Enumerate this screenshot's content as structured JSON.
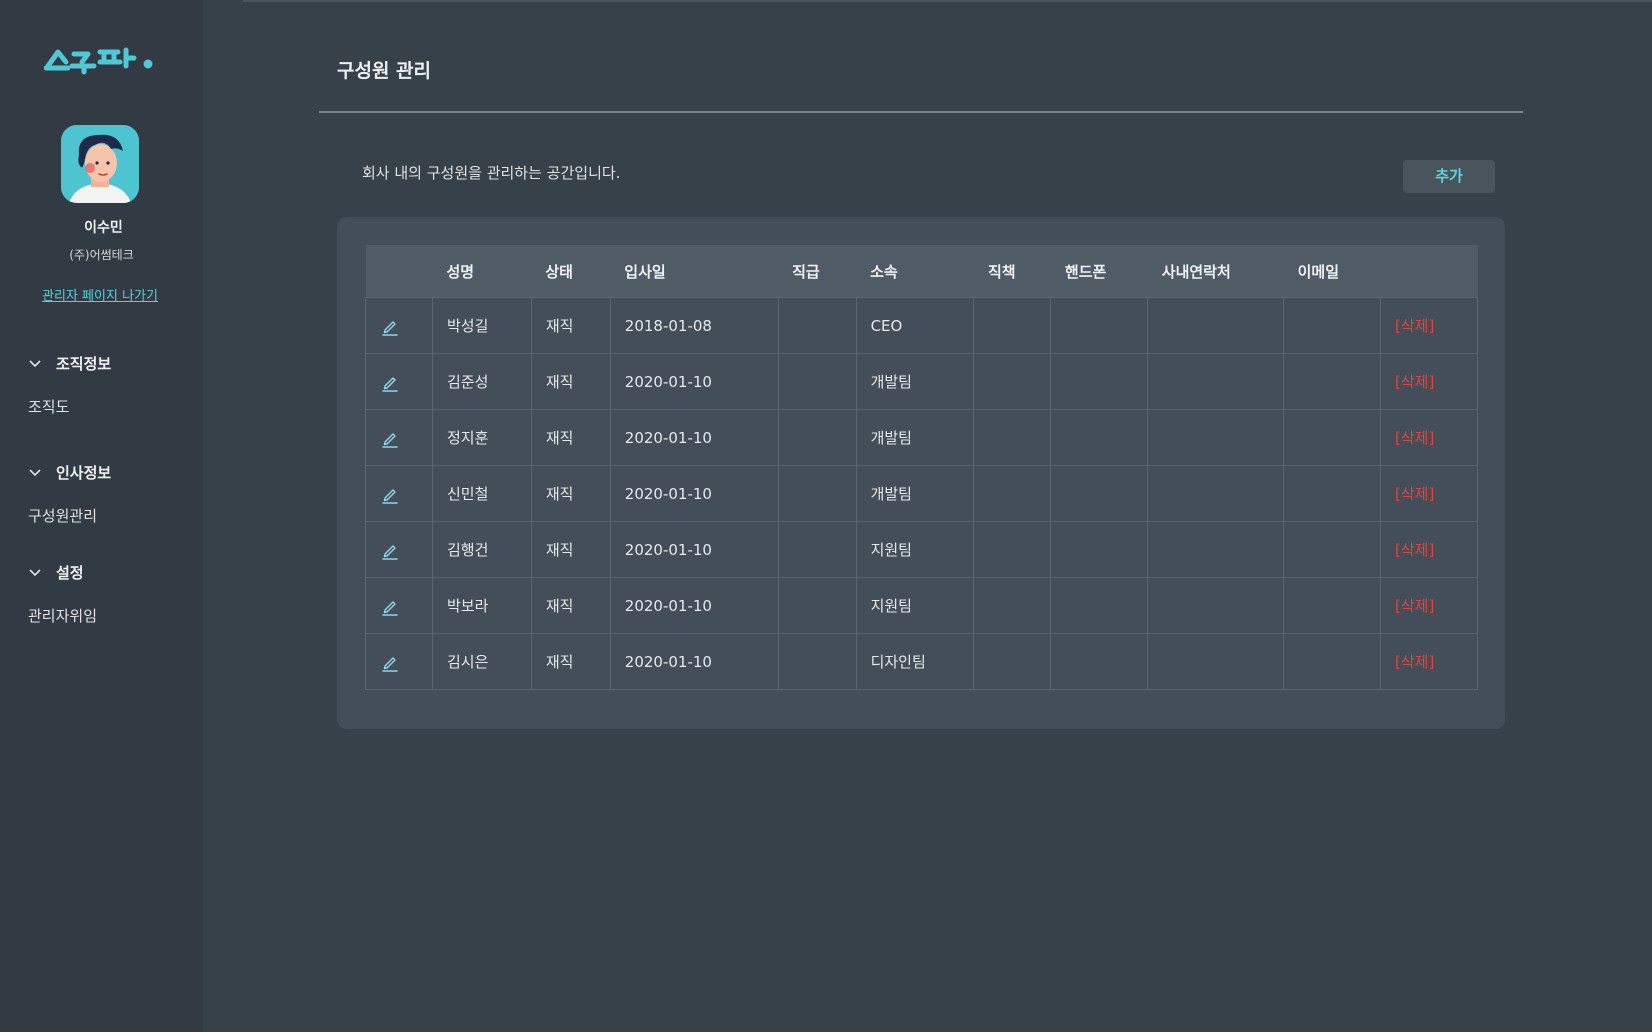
{
  "sidebar": {
    "logo_text": "스누퍼.",
    "user_name": "이수민",
    "company": "(주)어썸테크",
    "exit_link": "관리자 페이지 나가기",
    "sections": [
      {
        "title": "조직정보",
        "items": [
          "조직도"
        ]
      },
      {
        "title": "인사정보",
        "items": [
          "구성원관리"
        ]
      },
      {
        "title": "설정",
        "items": [
          "관리자위임"
        ]
      }
    ]
  },
  "main": {
    "title": "구성원 관리",
    "description": "회사 내의 구성원을 관리하는 공간입니다.",
    "add_button": "추가",
    "table": {
      "columns": [
        "",
        "성명",
        "상태",
        "입사일",
        "직급",
        "소속",
        "직책",
        "핸드폰",
        "사내연락처",
        "이메일",
        ""
      ],
      "delete_label": "[삭제]",
      "rows": [
        {
          "name": "박성길",
          "status": "재직",
          "join_date": "2018-01-08",
          "rank": "",
          "team": "CEO",
          "position": "",
          "mobile": "",
          "office": "",
          "email": ""
        },
        {
          "name": "김준성",
          "status": "재직",
          "join_date": "2020-01-10",
          "rank": "",
          "team": "개발팀",
          "position": "",
          "mobile": "",
          "office": "",
          "email": ""
        },
        {
          "name": "정지훈",
          "status": "재직",
          "join_date": "2020-01-10",
          "rank": "",
          "team": "개발팀",
          "position": "",
          "mobile": "",
          "office": "",
          "email": ""
        },
        {
          "name": "신민철",
          "status": "재직",
          "join_date": "2020-01-10",
          "rank": "",
          "team": "개발팀",
          "position": "",
          "mobile": "",
          "office": "",
          "email": ""
        },
        {
          "name": "김행건",
          "status": "재직",
          "join_date": "2020-01-10",
          "rank": "",
          "team": "지원팀",
          "position": "",
          "mobile": "",
          "office": "",
          "email": ""
        },
        {
          "name": "박보라",
          "status": "재직",
          "join_date": "2020-01-10",
          "rank": "",
          "team": "지원팀",
          "position": "",
          "mobile": "",
          "office": "",
          "email": ""
        },
        {
          "name": "김시은",
          "status": "재직",
          "join_date": "2020-01-10",
          "rank": "",
          "team": "디자인팀",
          "position": "",
          "mobile": "",
          "office": "",
          "email": ""
        }
      ]
    }
  },
  "colors": {
    "accent": "#54d1dd",
    "delete": "#e2443f",
    "background": "#37414a",
    "sidebar": "#323b43"
  },
  "icons": {
    "row_edit": "pencil-icon",
    "section_toggle": "chevron-down-icon"
  }
}
